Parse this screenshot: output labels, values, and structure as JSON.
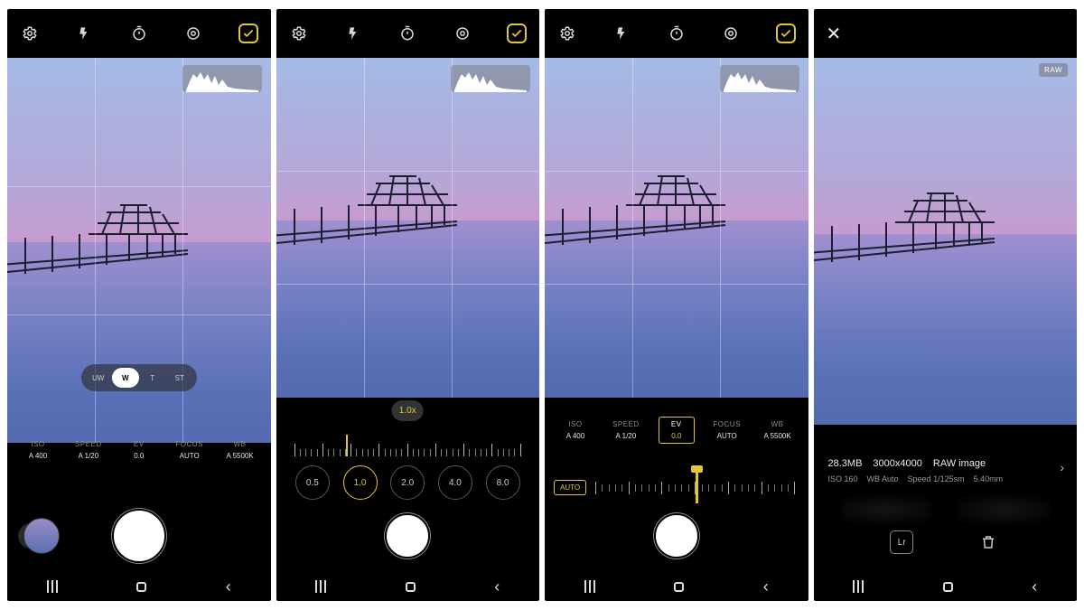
{
  "icons": {
    "settings": "settings",
    "flash": "flash",
    "timer": "timer",
    "ratio": "ratio",
    "format": "format",
    "close": "close"
  },
  "histogram_label": "histogram",
  "raw_badge": "RAW",
  "lenses": [
    "UW",
    "W",
    "T",
    "ST"
  ],
  "lens_selected": 1,
  "params": {
    "iso": {
      "label": "ISO",
      "value": "A 400"
    },
    "speed": {
      "label": "SPEED",
      "value": "A 1/20"
    },
    "ev": {
      "label": "EV",
      "value": "0.0"
    },
    "focus": {
      "label": "FOCUS",
      "value": "AUTO"
    },
    "wb": {
      "label": "WB",
      "value": "A 5500K"
    }
  },
  "zoom": {
    "current": "1.0x",
    "stops": [
      "0.5",
      "1.0",
      "2.0",
      "4.0",
      "8.0"
    ],
    "selected": 1
  },
  "ev_panel": {
    "auto_label": "AUTO"
  },
  "review": {
    "size": "28.3MB",
    "dimensions": "3000x4000",
    "format": "RAW image",
    "iso": "ISO 160",
    "wb": "WB Auto",
    "speed": "Speed 1/125sm",
    "focal": "5.40mm",
    "edit_label": "Lr"
  },
  "nav": {
    "recents": "recents",
    "home": "home",
    "back": "back"
  }
}
